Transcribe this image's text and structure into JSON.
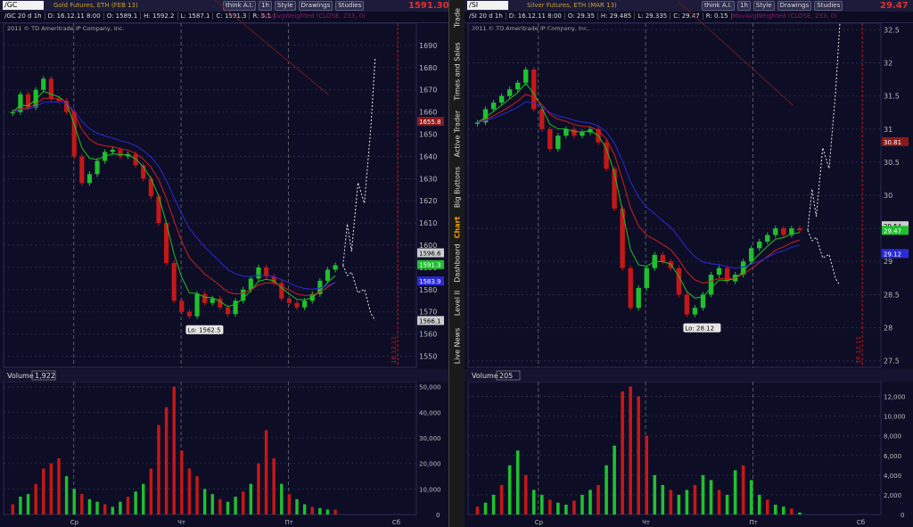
{
  "tabs": [
    "Trade",
    "Times and Sales",
    "Active Trader",
    "Big Buttons",
    "Chart",
    "Dashboard",
    "Level II",
    "Live News"
  ],
  "active_tab": "Chart",
  "toolbar": {
    "think": "think A.I.",
    "interval": "1h",
    "style": "Style",
    "drawings": "Drawings",
    "studies": "Studies"
  },
  "left": {
    "symbol": "/GC",
    "description": "Gold Futures, ETH (FEB 13)",
    "last": "1591.30",
    "stats": {
      "period": "/GC 20 d 1h",
      "date": "D: 16.12.11 8:00",
      "open": "O: 1589.1",
      "high": "H: 1592.2",
      "low": "L: 1587.1",
      "close": "C: 1591.3",
      "range": "R: 5.1"
    },
    "study": "MovAvgWeighted (CLOSE, 233, 0)",
    "copyright": "2011 © TD Ameritrade IP Company, Inc.",
    "volume_label": "Volume",
    "volume_value": "1,922",
    "lo_label": "Lo: 1562.5",
    "date_marker": "16.12.11"
  },
  "right": {
    "symbol": "/SI",
    "description": "Silver Futures, ETH (MAR 13)",
    "last": "29.47",
    "stats": {
      "period": "/SI 20 d 1h",
      "date": "D: 16.12.11 8:00",
      "open": "O: 29.35",
      "high": "H: 29.485",
      "low": "L: 29.335",
      "close": "C: 29.47",
      "range": "R: 0.15"
    },
    "study": "MovAvgWeighted (CLOSE, 233, 0)",
    "copyright": "2011 © TD Ameritrade IP Company, Inc.",
    "volume_label": "Volume",
    "volume_value": "205",
    "lo_label": "Lo: 28.12",
    "date_marker": "16.12.11"
  },
  "colors": {
    "up": "#1fc02f",
    "down": "#c41818",
    "ema_green": "#20c020",
    "ema_red": "#d02020",
    "ema_blue": "#2a2ad8",
    "long_ma": "#6a1a1a",
    "forecast": "#e8e8e8",
    "date_line": "#c41818"
  },
  "chart_data": [
    {
      "type": "candlestick",
      "name": "/GC",
      "title": "Gold Futures, ETH (FEB 13)",
      "ylim": [
        1545,
        1700
      ],
      "yticks": [
        1550,
        1560,
        1570,
        1580,
        1590,
        1600,
        1610,
        1620,
        1630,
        1640,
        1650,
        1660,
        1670,
        1680,
        1690
      ],
      "xticks": [
        "Ср",
        "Чт",
        "Пт",
        "Сб"
      ],
      "price_labels": [
        {
          "value": 1655.8,
          "text": "1655.8",
          "color": "#8a1a1a"
        },
        {
          "value": 1596.6,
          "text": "1596.6",
          "color": "#cccccc"
        },
        {
          "value": 1591.3,
          "text": "1591.3",
          "color": "#1fc02f"
        },
        {
          "value": 1583.9,
          "text": "1583.9",
          "color": "#2a2ad8"
        },
        {
          "value": 1566.1,
          "text": "1566.1",
          "color": "#cccccc"
        }
      ],
      "close": [
        1660,
        1668,
        1662,
        1670,
        1675,
        1666,
        1665,
        1660,
        1640,
        1628,
        1632,
        1638,
        1642,
        1643,
        1640,
        1641,
        1636,
        1630,
        1622,
        1610,
        1592,
        1575,
        1570,
        1568,
        1578,
        1574,
        1576,
        1572,
        1569,
        1575,
        1580,
        1585,
        1590,
        1586,
        1583,
        1576,
        1574,
        1572,
        1575,
        1578,
        1584,
        1589,
        1591
      ],
      "volume": {
        "ylim": [
          0,
          52000
        ],
        "yticks": [
          10000,
          20000,
          30000,
          40000,
          50000
        ],
        "values": [
          4000,
          7000,
          8000,
          12000,
          18000,
          20000,
          22000,
          15000,
          10000,
          8000,
          6000,
          5000,
          4000,
          3000,
          5000,
          7000,
          9000,
          12000,
          18000,
          35000,
          42000,
          50000,
          25000,
          18000,
          15000,
          10000,
          8000,
          6000,
          5000,
          7000,
          9000,
          12000,
          20000,
          33000,
          22000,
          12000,
          8000,
          6000,
          4000,
          3000,
          2500,
          2000,
          1922
        ]
      }
    },
    {
      "type": "candlestick",
      "name": "/SI",
      "title": "Silver Futures, ETH (MAR 13)",
      "ylim": [
        27.4,
        32.6
      ],
      "yticks": [
        27.5,
        28,
        28.5,
        29,
        29.5,
        30,
        30.5,
        31,
        31.5,
        32,
        32.5
      ],
      "xticks": [
        "Ср",
        "Чт",
        "Пт",
        "Сб"
      ],
      "price_labels": [
        {
          "value": 30.81,
          "text": "30.81",
          "color": "#8a1a1a"
        },
        {
          "value": 29.54,
          "text": "29.54",
          "color": "#cccccc"
        },
        {
          "value": 29.47,
          "text": "29.47",
          "color": "#1fc02f"
        },
        {
          "value": 29.12,
          "text": "29.12",
          "color": "#2a2ad8"
        }
      ],
      "close": [
        31.1,
        31.3,
        31.4,
        31.5,
        31.6,
        31.7,
        31.9,
        31.3,
        31.0,
        30.7,
        30.9,
        31.0,
        30.9,
        30.95,
        31.0,
        30.8,
        30.4,
        29.8,
        28.9,
        28.3,
        28.6,
        28.9,
        29.1,
        29.0,
        28.9,
        28.5,
        28.2,
        28.3,
        28.5,
        28.8,
        28.9,
        28.7,
        28.8,
        29.0,
        29.2,
        29.3,
        29.4,
        29.5,
        29.4,
        29.5,
        29.47
      ],
      "volume": {
        "ylim": [
          0,
          13500
        ],
        "yticks": [
          2000,
          4000,
          6000,
          8000,
          10000,
          12000
        ],
        "values": [
          800,
          1200,
          2000,
          3000,
          5000,
          6500,
          4000,
          2500,
          2000,
          1500,
          1200,
          1000,
          1400,
          2000,
          2500,
          3000,
          5000,
          7000,
          12500,
          13000,
          12000,
          8000,
          4000,
          3000,
          2500,
          2000,
          2500,
          3000,
          4000,
          3500,
          2500,
          2000,
          4500,
          5000,
          3500,
          2000,
          1500,
          1000,
          800,
          600,
          205
        ]
      }
    }
  ]
}
